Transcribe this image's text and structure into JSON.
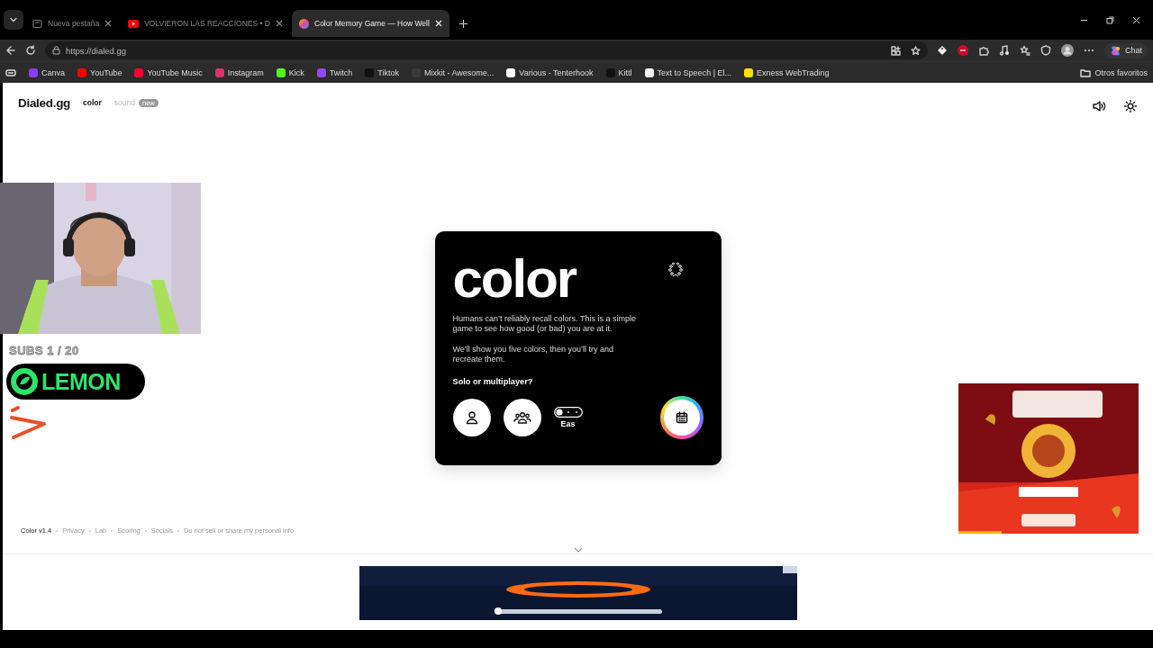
{
  "browser": {
    "tabs": [
      {
        "title": "Nueva pestaña",
        "kind": "blank",
        "selected": false
      },
      {
        "title": "VOLVIERON LAS REACCIONES • D",
        "kind": "video",
        "selected": false
      },
      {
        "title": "Color Memory Game — How Well",
        "kind": "color",
        "selected": true
      }
    ],
    "url": "https://dialed.gg",
    "bookmarks": [
      {
        "label": "Canva",
        "color": "#8b3dff"
      },
      {
        "label": "YouTube",
        "color": "#ff0000"
      },
      {
        "label": "YouTube Music",
        "color": "#ff0033"
      },
      {
        "label": "Instagram",
        "color": "#e1306c"
      },
      {
        "label": "Kick",
        "color": "#53fc18"
      },
      {
        "label": "Twitch",
        "color": "#9146ff"
      },
      {
        "label": "Tiktok",
        "color": "#111111"
      },
      {
        "label": "Mixkit - Awesome...",
        "color": "#3a3a3a"
      },
      {
        "label": "Various - Tenterhook",
        "color": "#ffffff"
      },
      {
        "label": "Kittl",
        "color": "#111111"
      },
      {
        "label": "Text to Speech | El...",
        "color": "#f2f2f2"
      },
      {
        "label": "Exness WebTrading",
        "color": "#ffde02"
      }
    ],
    "other_favorites": "Otros favoritos",
    "chat": "Chat"
  },
  "page": {
    "brand": "Dialed.gg",
    "nav": [
      {
        "label": "color",
        "selected": true
      },
      {
        "label": "sound",
        "selected": false,
        "badge": "new"
      }
    ],
    "card": {
      "title": "color",
      "paragraphs": [
        "Humans can’t reliably recall colors. This is a simple game to see how good (or bad) you are at it.",
        "We’ll show you five colors, then you’ll try and recreate them."
      ],
      "prompt": "Solo or multiplayer?",
      "difficulty": "Eas"
    },
    "footer": [
      {
        "label": "Color v1.4",
        "kind": "version"
      },
      {
        "label": "Privacy",
        "kind": "link"
      },
      {
        "label": "Lab",
        "kind": "link"
      },
      {
        "label": "Scoring",
        "kind": "link"
      },
      {
        "label": "Socials",
        "kind": "link"
      },
      {
        "label": "Do not sell or share my personal info",
        "kind": "link"
      }
    ]
  },
  "overlay": {
    "subs": "SUBS 1 / 20",
    "logo": "LEMON"
  }
}
